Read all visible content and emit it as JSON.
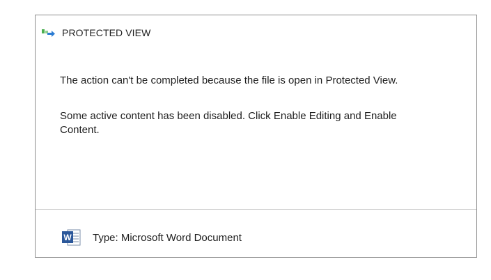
{
  "header": {
    "title": "PROTECTED VIEW",
    "icon": "protected-view-icon"
  },
  "messages": {
    "line1": "The action can't be completed because the file is open in Protected View.",
    "line2": "Some active content has been disabled. Click Enable Editing and Enable Content."
  },
  "footer": {
    "type_label": "Type: Microsoft Word Document",
    "icon": "word-document-icon"
  },
  "colors": {
    "border": "#8c8c8c",
    "icon_green": "#4caf50",
    "icon_blue": "#2b7cd3",
    "word_blue": "#2b579a"
  }
}
